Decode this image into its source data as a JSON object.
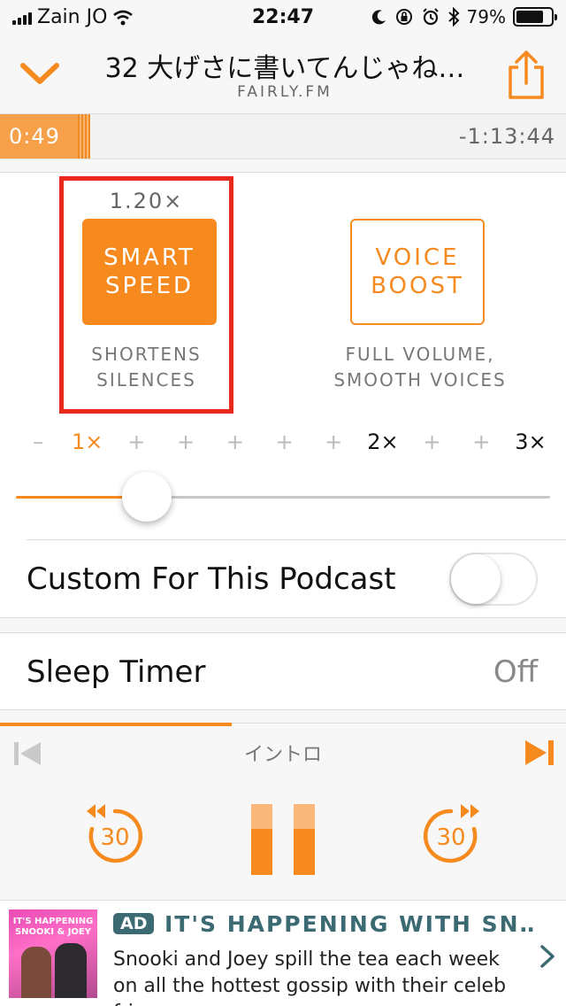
{
  "status": {
    "carrier": "Zain JO",
    "time": "22:47",
    "battery": "79%",
    "battery_level": 0.79
  },
  "header": {
    "title": "32 大げさに書いてんじゃね…",
    "subtitle": "FAIRLY.FM",
    "collapse_icon": "chevron-down-icon",
    "share_icon": "share-icon"
  },
  "progress": {
    "elapsed": "0:49",
    "remaining": "-1:13:44"
  },
  "effects": {
    "speed_value": "1.20×",
    "smart_speed_label": "SMART SPEED",
    "smart_speed_line1": "SMART",
    "smart_speed_line2": "SPEED",
    "smart_speed_desc1": "SHORTENS",
    "smart_speed_desc2": "SILENCES",
    "voice_boost_line1": "VOICE",
    "voice_boost_line2": "BOOST",
    "voice_boost_desc1": "FULL VOLUME,",
    "voice_boost_desc2": "SMOOTH VOICES",
    "accent": "#f68a1e",
    "highlight_color": "#e8291c"
  },
  "speed_scale": {
    "marks": [
      "–",
      "1×",
      "+",
      "+",
      "+",
      "+",
      "+",
      "2×",
      "+",
      "+",
      "3×"
    ],
    "current_speed": 1.2,
    "min": 0.8,
    "max": 3.0
  },
  "custom_podcast": {
    "label": "Custom For This Podcast",
    "enabled": false
  },
  "sleep_timer": {
    "label": "Sleep Timer",
    "value": "Off"
  },
  "player": {
    "chapter_title": "イントロ",
    "chapter_progress": 0.41,
    "skip_back_seconds": "30",
    "skip_forward_seconds": "30",
    "pause_icon": "pause-icon"
  },
  "ad": {
    "badge": "AD",
    "title": "IT'S HAPPENING WITH SN…",
    "body": "Snooki and Joey spill the tea each week on all the hottest gossip with their celeb frie…",
    "art_title": "IT'S HAPPENING SNOOKI & JOEY",
    "title_color": "#3b6a72"
  }
}
